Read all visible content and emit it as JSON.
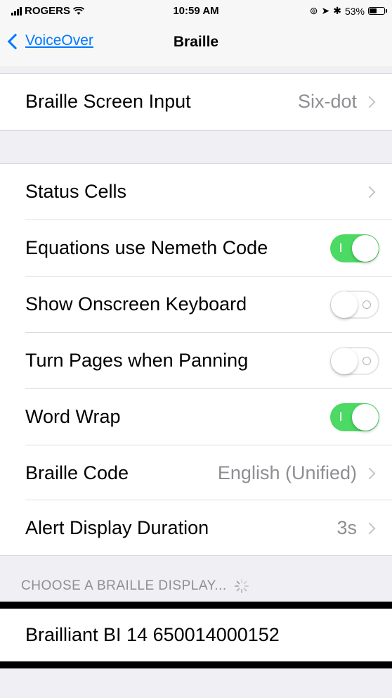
{
  "status_bar": {
    "carrier": "ROGERS",
    "time": "10:59 AM",
    "battery": "53%",
    "battery_level": 0.53
  },
  "nav": {
    "back_label": "VoiceOver",
    "title": "Braille"
  },
  "rows": {
    "braille_screen_input": {
      "label": "Braille Screen Input",
      "value": "Six-dot"
    },
    "status_cells": {
      "label": "Status Cells"
    },
    "equations_nemeth": {
      "label": "Equations use Nemeth Code",
      "on": true
    },
    "show_onscreen_keyboard": {
      "label": "Show Onscreen Keyboard",
      "on": false
    },
    "turn_pages_panning": {
      "label": "Turn Pages when Panning",
      "on": false
    },
    "word_wrap": {
      "label": "Word Wrap",
      "on": true
    },
    "braille_code": {
      "label": "Braille Code",
      "value": "English (Unified)"
    },
    "alert_display_duration": {
      "label": "Alert Display Duration",
      "value": "3s"
    }
  },
  "display_section": {
    "header": "CHOOSE A BRAILLE DISPLAY...",
    "device_name": "Brailliant BI 14 650014000152"
  },
  "colors": {
    "accent": "#007aff",
    "toggle_on": "#4cd964",
    "secondary_text": "#8e8e93",
    "background": "#efeff4"
  }
}
